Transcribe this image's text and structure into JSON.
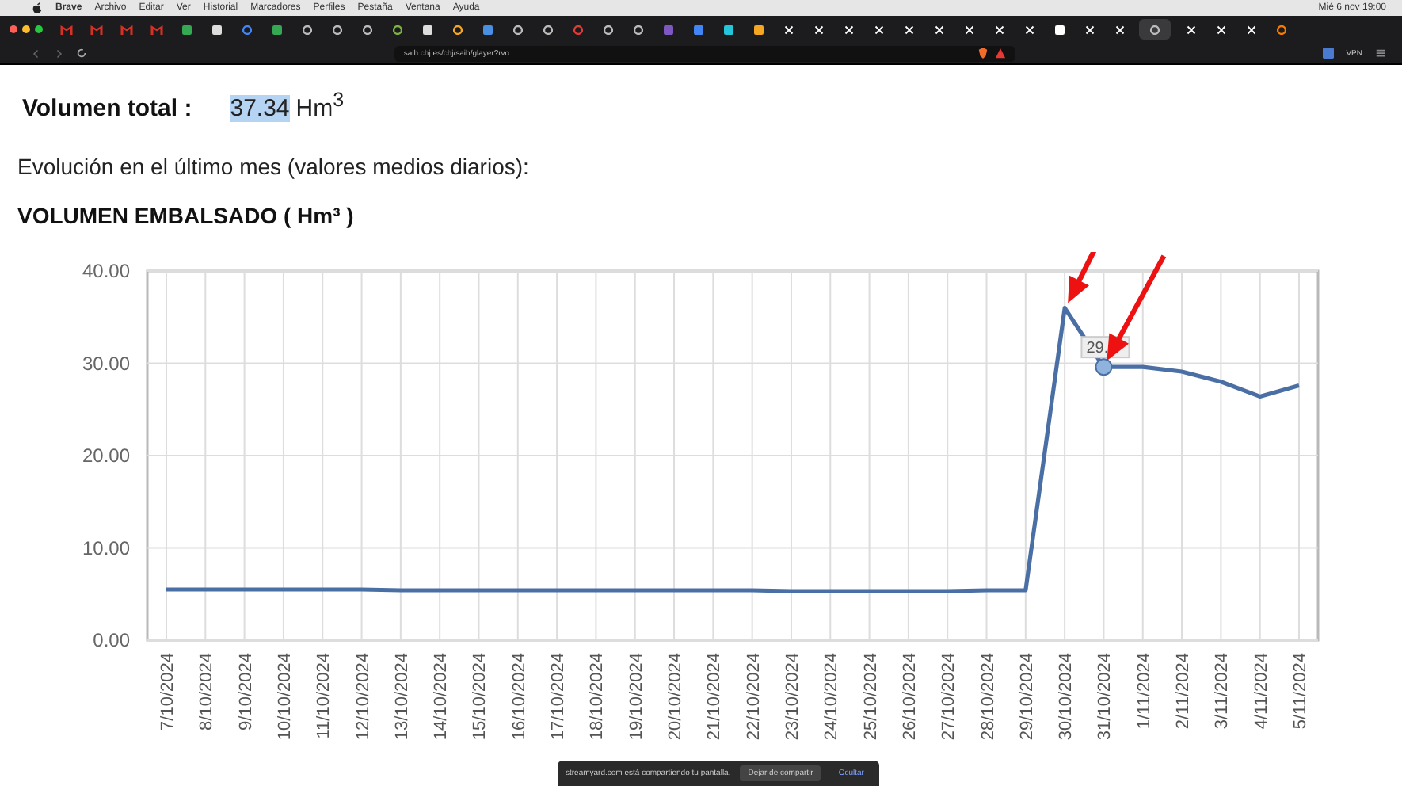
{
  "menu_bar": {
    "app": "Brave",
    "items": [
      "Archivo",
      "Editar",
      "Ver",
      "Historial",
      "Marcadores",
      "Perfiles",
      "Pestaña",
      "Ventana",
      "Ayuda"
    ],
    "clock": "Mié 6 nov 19:00"
  },
  "tabs": [
    {
      "kind": "mail",
      "color": "#d93025",
      "selected": false
    },
    {
      "kind": "mail",
      "color": "#d93025",
      "selected": false
    },
    {
      "kind": "mail",
      "color": "#d93025",
      "selected": false
    },
    {
      "kind": "mail",
      "color": "#d93025",
      "selected": false
    },
    {
      "kind": "square",
      "color": "#34a853",
      "selected": false
    },
    {
      "kind": "square",
      "color": "#dddddd",
      "selected": false
    },
    {
      "kind": "globe",
      "color": "#4285f4",
      "selected": false
    },
    {
      "kind": "square",
      "color": "#34a853",
      "selected": false
    },
    {
      "kind": "globe",
      "color": "#bbbbbb",
      "selected": false
    },
    {
      "kind": "globe",
      "color": "#bbbbbb",
      "selected": false
    },
    {
      "kind": "globe",
      "color": "#bbbbbb",
      "selected": false
    },
    {
      "kind": "globe",
      "color": "#7cb342",
      "selected": false
    },
    {
      "kind": "square",
      "color": "#dddddd",
      "selected": false
    },
    {
      "kind": "globe",
      "color": "#f5a623",
      "selected": false
    },
    {
      "kind": "square",
      "color": "#4a90e2",
      "selected": false
    },
    {
      "kind": "globe",
      "color": "#bbbbbb",
      "selected": false
    },
    {
      "kind": "globe",
      "color": "#bbbbbb",
      "selected": false
    },
    {
      "kind": "globe",
      "color": "#e53935",
      "selected": false
    },
    {
      "kind": "globe",
      "color": "#bbbbbb",
      "selected": false
    },
    {
      "kind": "globe",
      "color": "#bbbbbb",
      "selected": false
    },
    {
      "kind": "square",
      "color": "#7e57c2",
      "selected": false
    },
    {
      "kind": "square",
      "color": "#4285f4",
      "selected": false
    },
    {
      "kind": "square",
      "color": "#26c6da",
      "selected": false
    },
    {
      "kind": "square",
      "color": "#f5a623",
      "selected": false
    },
    {
      "kind": "x",
      "color": "#ffffff",
      "selected": false
    },
    {
      "kind": "x",
      "color": "#ffffff",
      "selected": false
    },
    {
      "kind": "x",
      "color": "#ffffff",
      "selected": false
    },
    {
      "kind": "x",
      "color": "#ffffff",
      "selected": false
    },
    {
      "kind": "x",
      "color": "#ffffff",
      "selected": false
    },
    {
      "kind": "x",
      "color": "#ffffff",
      "selected": false
    },
    {
      "kind": "x",
      "color": "#ffffff",
      "selected": false
    },
    {
      "kind": "x",
      "color": "#ffffff",
      "selected": false
    },
    {
      "kind": "x",
      "color": "#ffffff",
      "selected": false
    },
    {
      "kind": "square",
      "color": "#ffffff",
      "selected": false
    },
    {
      "kind": "x",
      "color": "#ffffff",
      "selected": false
    },
    {
      "kind": "x",
      "color": "#ffffff",
      "selected": false
    },
    {
      "kind": "globe",
      "color": "#bbbbbb",
      "selected": true
    },
    {
      "kind": "x",
      "color": "#ffffff",
      "selected": false
    },
    {
      "kind": "x",
      "color": "#ffffff",
      "selected": false
    },
    {
      "kind": "x",
      "color": "#ffffff",
      "selected": false
    },
    {
      "kind": "globe",
      "color": "#f57c00",
      "selected": false
    }
  ],
  "address_bar": {
    "url": "saih.chj.es/chj/saih/glayer?rvo"
  },
  "toolbar": {
    "vpn": "VPN"
  },
  "total": {
    "label": "Volumen total :",
    "value": "37.34",
    "selected": true,
    "unit": "Hm$^{3}$"
  },
  "subtitle": "Evolución en el último mes (valores medios diarios):",
  "chart": {
    "chart_data": {
      "type": "line",
      "title": "VOLUMEN EMBALSADO ( Hm³ )",
      "categories": [
        "7/10/2024",
        "8/10/2024",
        "9/10/2024",
        "10/10/2024",
        "11/10/2024",
        "12/10/2024",
        "13/10/2024",
        "14/10/2024",
        "15/10/2024",
        "16/10/2024",
        "17/10/2024",
        "18/10/2024",
        "19/10/2024",
        "20/10/2024",
        "21/10/2024",
        "22/10/2024",
        "23/10/2024",
        "24/10/2024",
        "25/10/2024",
        "26/10/2024",
        "27/10/2024",
        "28/10/2024",
        "29/10/2024",
        "30/10/2024",
        "31/10/2024",
        "1/11/2024",
        "2/11/2024",
        "3/11/2024",
        "4/11/2024",
        "5/11/2024"
      ],
      "series": [
        {
          "color": "#4a6fa5",
          "values": [
            5.5,
            5.5,
            5.5,
            5.5,
            5.5,
            5.5,
            5.4,
            5.4,
            5.4,
            5.4,
            5.4,
            5.4,
            5.4,
            5.4,
            5.4,
            5.4,
            5.3,
            5.3,
            5.3,
            5.3,
            5.3,
            5.4,
            5.4,
            36.0,
            29.6,
            29.6,
            29.1,
            28.0,
            26.4,
            27.6
          ]
        }
      ],
      "grid": true,
      "ylim": [
        0,
        40
      ],
      "yticks": [
        {
          "value": 0,
          "label": "0.00"
        },
        {
          "value": 10,
          "label": "10.00"
        },
        {
          "value": 20,
          "label": "20.00"
        },
        {
          "value": 30,
          "label": "30.00"
        },
        {
          "value": 40,
          "label": "40.00"
        }
      ],
      "annotations": [
        {
          "x": "31/10/2024",
          "text": "29."
        }
      ]
    }
  },
  "share_banner": {
    "message": "streamyard.com está compartiendo tu pantalla.",
    "buttons": [
      "Dejar de compartir",
      "Ocultar"
    ]
  }
}
